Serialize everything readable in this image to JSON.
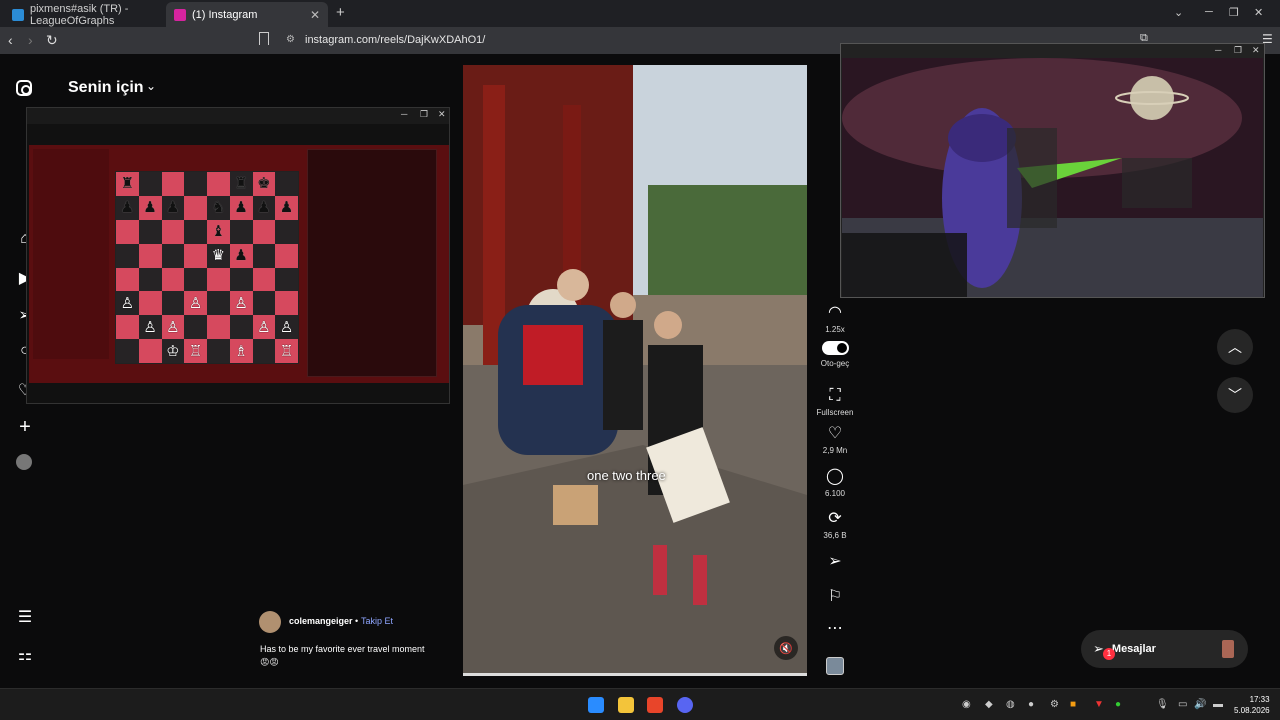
{
  "tabs": [
    {
      "label": "pixmens#asik (TR) - LeagueOfGraphs",
      "favicon_color": "#2b8cd6"
    },
    {
      "label": "(1) Instagram",
      "favicon_color": "#d6249f"
    }
  ],
  "browser": {
    "url": "instagram.com/reels/DajKwXDAhO1/",
    "new_tab": "+"
  },
  "instagram": {
    "feed_title": "Senin için",
    "nav_icons": [
      "home-icon",
      "reels-icon",
      "direct-icon",
      "search-icon",
      "heart-icon",
      "plus-icon",
      "avatar",
      "menu-icon",
      "more-apps-icon"
    ]
  },
  "reel": {
    "caption": "one two three",
    "author": "colemangeiger",
    "separator": "•",
    "follow_label": "Takip Et",
    "description": "Has to be my favorite ever travel moment",
    "emoji": "😡😡",
    "mute_icon": "muted-speaker-icon"
  },
  "rail": {
    "speed": "1.25x",
    "autoplay": "Oto-geç",
    "fullscreen": "Fullscreen",
    "likes": "2,9 Mn",
    "comments": "6.100",
    "reposts": "36,6 B"
  },
  "messages": {
    "label": "Mesajlar",
    "badge": "1"
  },
  "taskbar": {
    "time": "17:33",
    "date": "5.08.2026"
  },
  "colors": {
    "ig_bg": "#0b0b0c",
    "accent_link": "#8fa6ff",
    "badge_red": "#ff3040"
  }
}
